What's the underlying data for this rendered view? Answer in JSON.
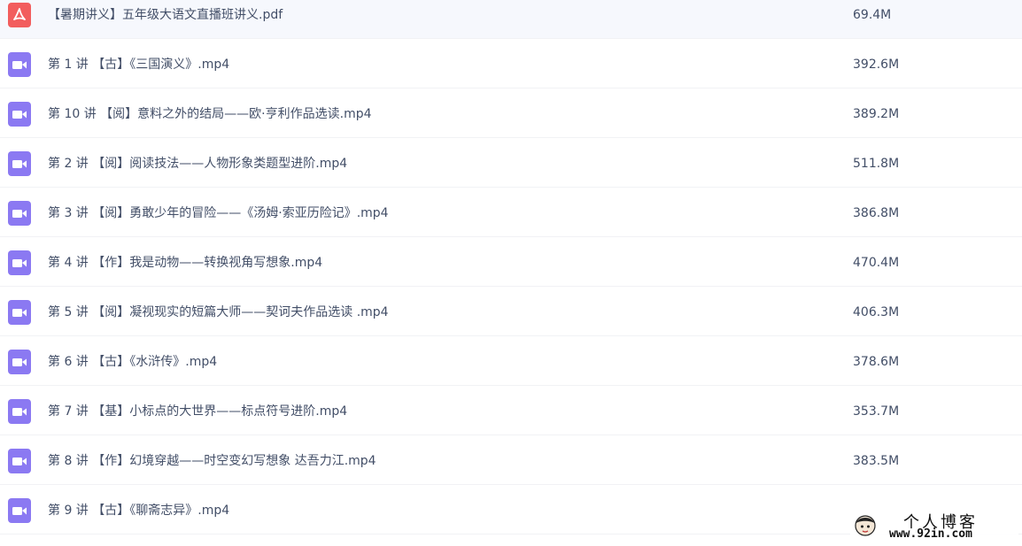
{
  "files": [
    {
      "name": "【暑期讲义】五年级大语文直播班讲义.pdf",
      "size": "69.4M",
      "icon": "pdf-icon"
    },
    {
      "name": "第 1 讲 【古】《三国演义》.mp4",
      "size": "392.6M",
      "icon": "video-icon"
    },
    {
      "name": "第 10 讲 【阅】意料之外的结局——欧·亨利作品选读.mp4",
      "size": "389.2M",
      "icon": "video-icon"
    },
    {
      "name": "第 2 讲 【阅】阅读技法——人物形象类题型进阶.mp4",
      "size": "511.8M",
      "icon": "video-icon"
    },
    {
      "name": "第 3 讲 【阅】勇敢少年的冒险——《汤姆·索亚历险记》.mp4",
      "size": "386.8M",
      "icon": "video-icon"
    },
    {
      "name": "第 4 讲 【作】我是动物——转换视角写想象.mp4",
      "size": "470.4M",
      "icon": "video-icon"
    },
    {
      "name": "第 5 讲 【阅】凝视现实的短篇大师——契诃夫作品选读 .mp4",
      "size": "406.3M",
      "icon": "video-icon"
    },
    {
      "name": "第 6 讲 【古】《水浒传》.mp4",
      "size": "378.6M",
      "icon": "video-icon"
    },
    {
      "name": "第 7 讲 【基】小标点的大世界——标点符号进阶.mp4",
      "size": "353.7M",
      "icon": "video-icon"
    },
    {
      "name": "第 8 讲 【作】幻境穿越——时空变幻写想象 达吾力江.mp4",
      "size": "383.5M",
      "icon": "video-icon"
    },
    {
      "name": "第 9 讲 【古】《聊斋志异》.mp4",
      "size": "",
      "icon": "video-icon"
    }
  ],
  "watermark": {
    "title": "个人博客",
    "url": "www.92in.com"
  },
  "colors": {
    "video_icon": "#8b79f2",
    "pdf_icon": "#f25d5d",
    "text": "#424e67",
    "divider": "#f1f2f5"
  }
}
